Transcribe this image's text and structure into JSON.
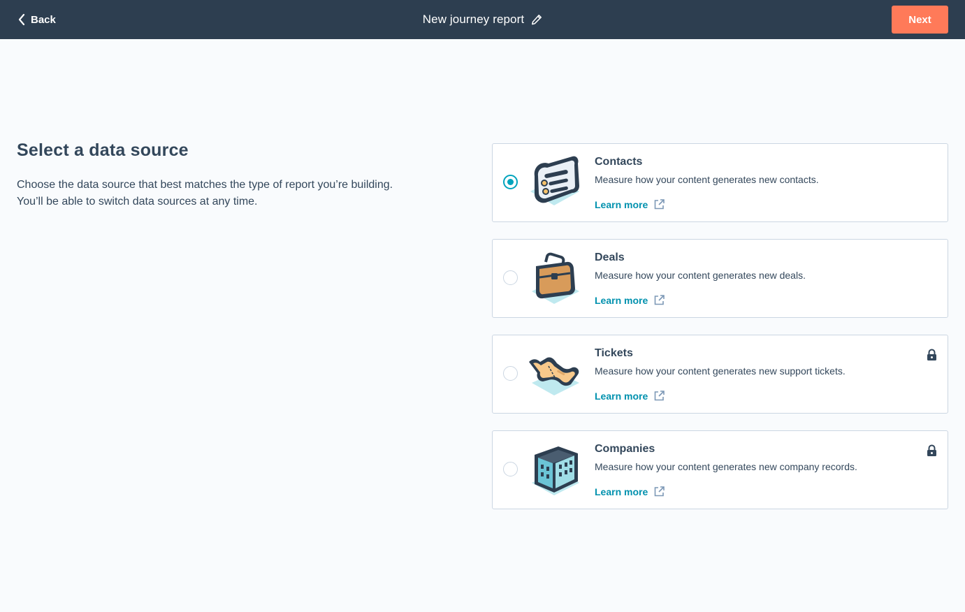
{
  "header": {
    "back_label": "Back",
    "title": "New journey report",
    "next_label": "Next"
  },
  "main": {
    "heading": "Select a data source",
    "description_line1": "Choose the data source that best matches the type of report you’re building.",
    "description_line2": "You’ll be able to switch data sources at any time."
  },
  "sources": [
    {
      "title": "Contacts",
      "description": "Measure how your content generates new contacts.",
      "link_label": "Learn more",
      "selected": true,
      "locked": false,
      "icon": "contacts-illustration"
    },
    {
      "title": "Deals",
      "description": "Measure how your content generates new deals.",
      "link_label": "Learn more",
      "selected": false,
      "locked": false,
      "icon": "briefcase-illustration"
    },
    {
      "title": "Tickets",
      "description": "Measure how your content generates new support tickets.",
      "link_label": "Learn more",
      "selected": false,
      "locked": true,
      "icon": "ticket-illustration"
    },
    {
      "title": "Companies",
      "description": "Measure how your content generates new company records.",
      "link_label": "Learn more",
      "selected": false,
      "locked": true,
      "icon": "building-illustration"
    }
  ],
  "colors": {
    "header_bg": "#2d3e50",
    "accent": "#ff7a59",
    "link": "#0091ae",
    "radio_selected": "#00a4bd",
    "text": "#33475b"
  }
}
